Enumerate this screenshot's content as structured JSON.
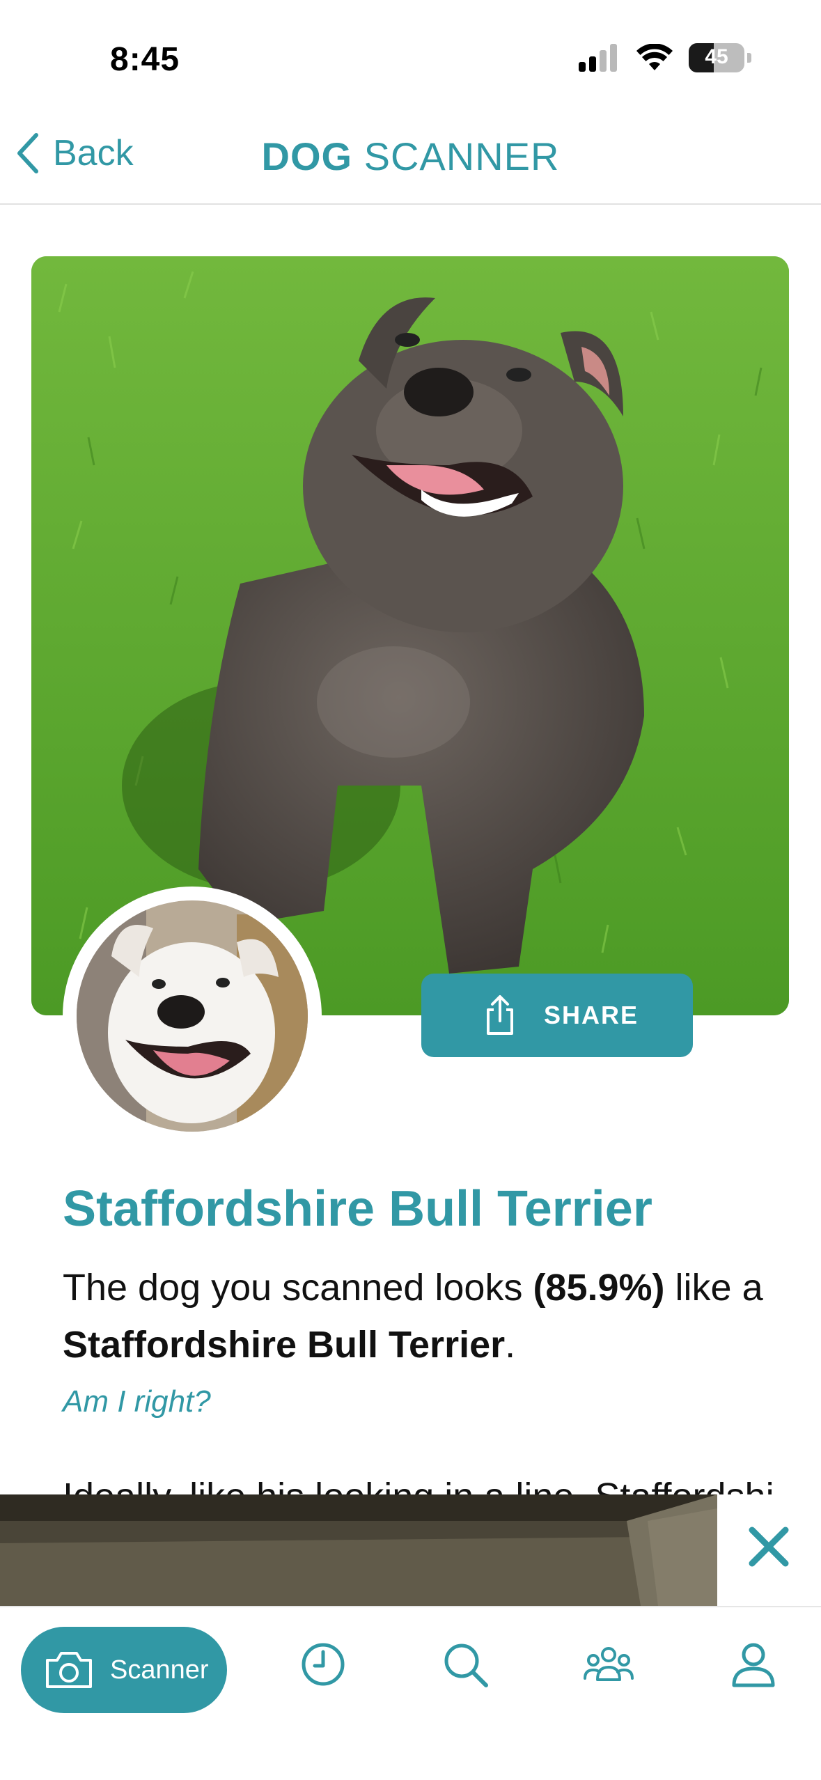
{
  "status_bar": {
    "time": "8:45",
    "battery": "45",
    "battery_level": 0.45
  },
  "nav": {
    "back_label": "Back",
    "title_bold": "DOG",
    "title_rest": " SCANNER"
  },
  "share": {
    "label": "SHARE"
  },
  "result": {
    "breed": "Staffordshire Bull Terrier",
    "line_start": "The dog you scanned looks ",
    "confidence": "(85.9%)",
    "line_mid": "  like a ",
    "breed_bold": "Staffordshire Bull Terrier",
    "line_end": ".",
    "question": "Am I right?",
    "peek": "Ideally, like his looking in a line, Staffordshi"
  },
  "tab_bar": {
    "scanner_label": "Scanner"
  },
  "icons": [
    "chevron-left-icon",
    "share-icon",
    "close-icon",
    "camera-icon",
    "history-clock-icon",
    "search-icon",
    "community-icon",
    "profile-icon",
    "signal-icon",
    "wifi-icon",
    "battery-icon"
  ],
  "colors": {
    "accent": "#3198a5",
    "text": "#111111",
    "divider": "#e2e2e2"
  }
}
